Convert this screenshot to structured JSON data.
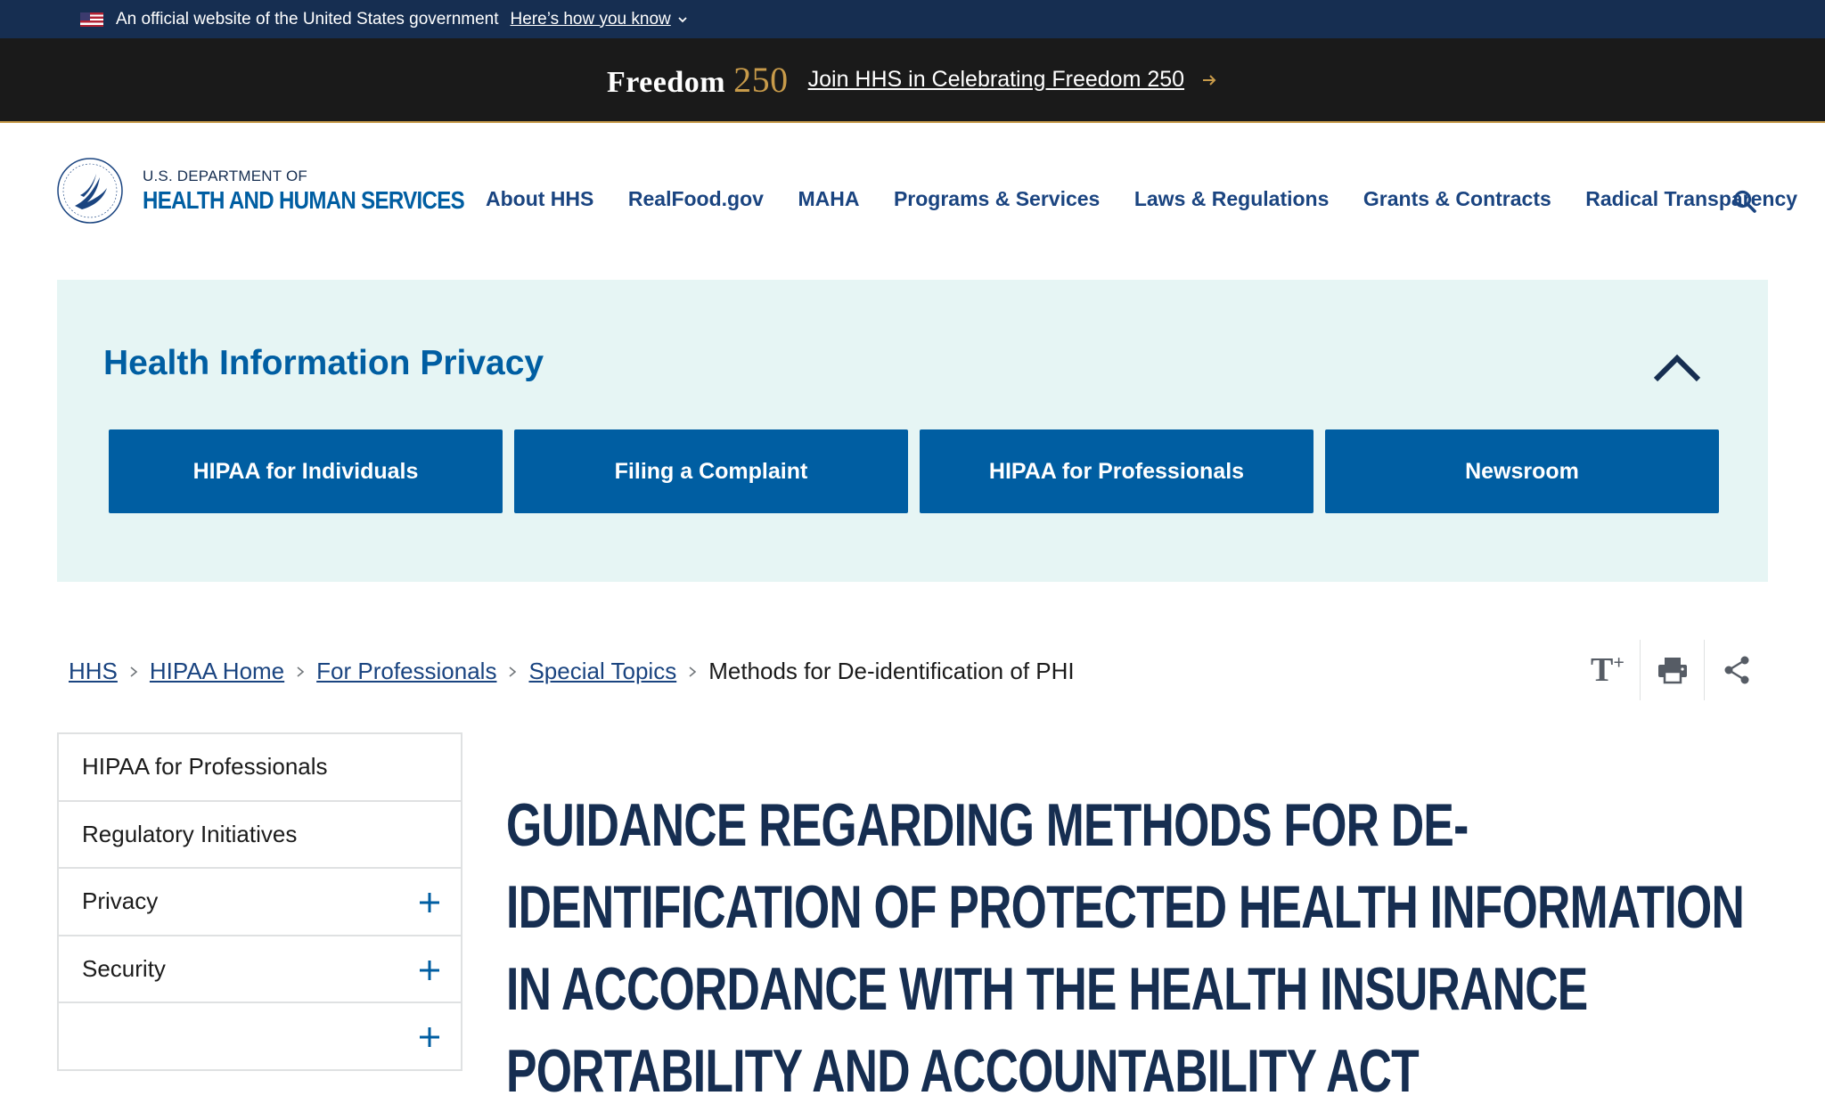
{
  "gov_banner": {
    "official_text": "An official website of the United States government",
    "how_link": "Here’s how you know"
  },
  "freedom_banner": {
    "logo_word": "Freedom",
    "logo_number": "250",
    "link_text": "Join HHS in Celebrating Freedom 250"
  },
  "header": {
    "logo_line1": "U.S. DEPARTMENT OF",
    "logo_line2": "HEALTH AND HUMAN SERVICES",
    "nav": [
      "About HHS",
      "RealFood.gov",
      "MAHA",
      "Programs & Services",
      "Laws & Regulations",
      "Grants & Contracts",
      "Radical Transparency"
    ]
  },
  "hip": {
    "title": "Health Information Privacy",
    "buttons": [
      "HIPAA for Individuals",
      "Filing a Complaint",
      "HIPAA for Professionals",
      "Newsroom"
    ]
  },
  "breadcrumb": {
    "links": [
      "HHS",
      "HIPAA Home",
      "For Professionals",
      "Special Topics"
    ],
    "current": "Methods for De-identification of PHI"
  },
  "tools": {
    "text_size": "T",
    "text_size_plus": "+"
  },
  "side_nav": {
    "items": [
      "HIPAA for Professionals",
      "Regulatory Initiatives",
      "Privacy",
      "Security",
      ""
    ]
  },
  "main": {
    "heading": "Guidance Regarding Methods for De-identification of Protected Health Information in Accordance with the Health Insurance Portability and Accountability Act"
  },
  "colors": {
    "gov_banner_bg": "#162e51",
    "freedom_bg": "#1a1a1a",
    "gold": "#c89b4a",
    "primary_blue": "#005ea2",
    "nav_blue": "#1a4480",
    "panel_bg": "#e6f5f4",
    "heading_navy": "#162e51"
  }
}
